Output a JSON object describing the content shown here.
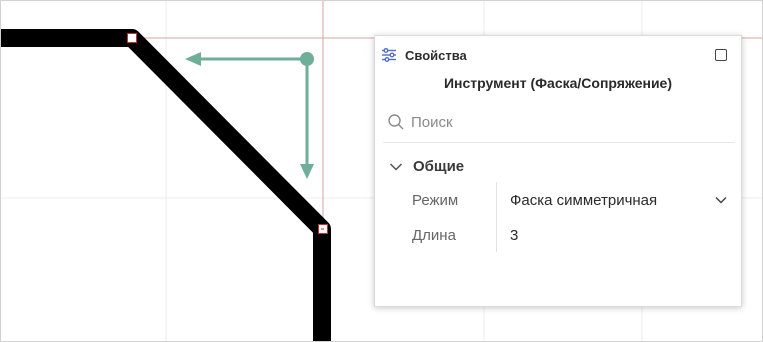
{
  "panel": {
    "title": "Свойства",
    "tool_title": "Инструмент (Фаска/Сопряжение)",
    "search": {
      "placeholder": "Поиск",
      "value": ""
    },
    "group": {
      "title": "Общие",
      "properties": [
        {
          "label": "Режим",
          "value": "Фаска симметричная",
          "dropdown": true
        },
        {
          "label": "Длина",
          "value": "3"
        }
      ]
    },
    "icons": {
      "properties": "sliders-icon",
      "maximize": "maximize-icon",
      "search": "search-icon",
      "group_toggle": "chevron-down-icon",
      "mode_dropdown": "chevron-down-icon"
    }
  },
  "colors": {
    "accent": "#4f6ec8",
    "track": "#000000",
    "arrow": "#6fae97",
    "guide": "#d9a3a3",
    "grid": "#ececec"
  }
}
